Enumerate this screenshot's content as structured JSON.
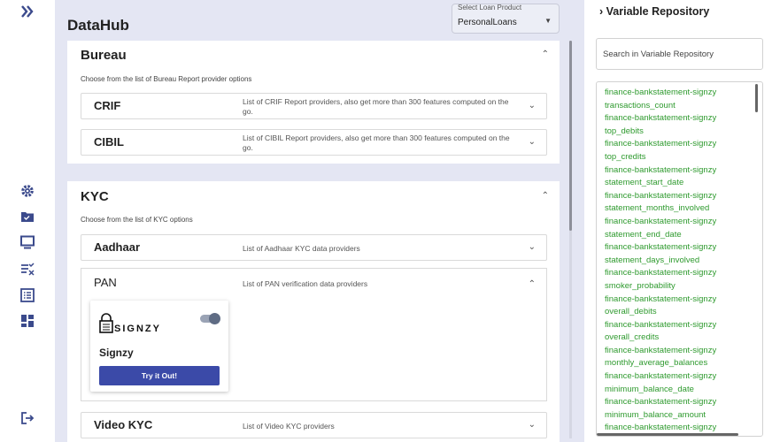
{
  "app": {
    "title": "DataHub"
  },
  "icons": {
    "brand_color": "#3b4a8c",
    "accent_button": "#3b4aa8",
    "list_text_color": "#2e9a2e"
  },
  "loan_product": {
    "label": "Select Loan Product",
    "value": "PersonalLoans"
  },
  "bureau": {
    "title": "Bureau",
    "subtitle": "Choose from the list of Bureau Report provider options",
    "providers": [
      {
        "name": "CRIF",
        "desc": "List of CRIF Report providers, also get more than 300 features computed on the go."
      },
      {
        "name": "CIBIL",
        "desc": "List of CIBIL Report providers, also get more than 300 features computed on the go."
      }
    ]
  },
  "kyc": {
    "title": "KYC",
    "subtitle": "Choose from the list of KYC options",
    "providers": [
      {
        "name": "Aadhaar",
        "desc": "List of Aadhaar KYC data providers"
      },
      {
        "name": "PAN",
        "desc": "List of PAN verification data providers"
      },
      {
        "name": "Video KYC",
        "desc": "List of Video KYC providers"
      }
    ],
    "pan_vendor": {
      "logo_text": "SIGNZY",
      "name": "Signzy",
      "button": "Try it Out!",
      "enabled": true
    }
  },
  "repository": {
    "title": "Variable Repository",
    "search_placeholder": "Search in Variable Repository",
    "items": [
      "finance-bankstatement-signzy",
      "transactions_count",
      "finance-bankstatement-signzy",
      "top_debits",
      "finance-bankstatement-signzy",
      "top_credits",
      "finance-bankstatement-signzy",
      "statement_start_date",
      "finance-bankstatement-signzy",
      "statement_months_involved",
      "finance-bankstatement-signzy",
      "statement_end_date",
      "finance-bankstatement-signzy",
      "statement_days_involved",
      "finance-bankstatement-signzy",
      "smoker_probability",
      "finance-bankstatement-signzy",
      "overall_debits",
      "finance-bankstatement-signzy",
      "overall_credits",
      "finance-bankstatement-signzy",
      "monthly_average_balances",
      "finance-bankstatement-signzy",
      "minimum_balance_date",
      "finance-bankstatement-signzy",
      "minimum_balance_amount",
      "finance-bankstatement-signzy"
    ]
  }
}
